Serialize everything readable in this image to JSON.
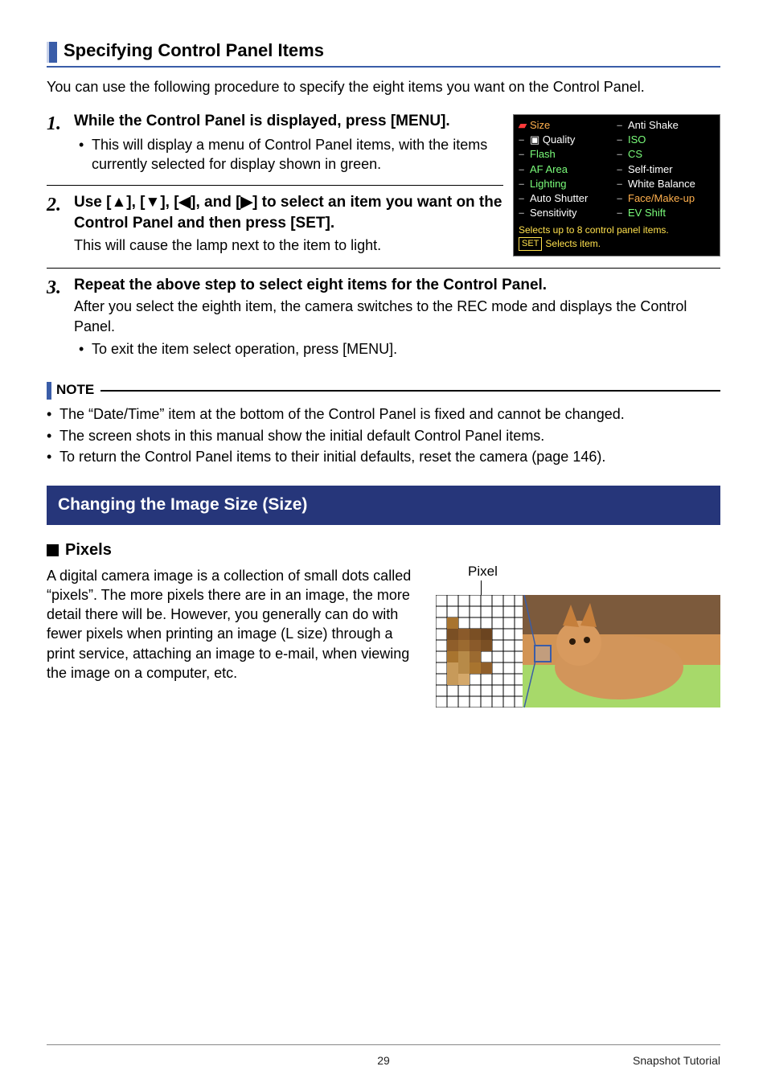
{
  "section1": {
    "title": "Specifying Control Panel Items",
    "intro": "You can use the following procedure to specify the eight items you want on the Control Panel."
  },
  "steps": {
    "s1": {
      "num": "1.",
      "title": "While the Control Panel is displayed, press [MENU].",
      "bullet": "This will display a menu of Control Panel items, with the items currently selected for display shown in green."
    },
    "s2": {
      "num": "2.",
      "title_pre": "Use [",
      "title_mid1": "], [",
      "title_mid2": "], [",
      "title_mid3": "], and [",
      "title_post": "] to select an item you want on the Control Panel and then press [SET].",
      "sub": "This will cause the lamp next to the item to light."
    },
    "s3": {
      "num": "3.",
      "title": "Repeat the above step to select eight items for the Control Panel.",
      "sub": "After you select the eighth item, the camera switches to the REC mode and displays the Control Panel.",
      "bullet": "To exit the item select operation, press [MENU]."
    }
  },
  "camera_menu": {
    "left": [
      "Size",
      "  Quality",
      "Flash",
      "AF Area",
      "Lighting",
      "Auto Shutter",
      "Sensitivity"
    ],
    "right": [
      "Anti Shake",
      "ISO",
      "CS",
      "Self-timer",
      "White Balance",
      "Face/Make-up",
      "EV Shift"
    ],
    "footer1": "Selects up to 8 control panel items.",
    "footer2_prefix": "SET",
    "footer2_text": "Selects item."
  },
  "note": {
    "label": "NOTE",
    "items": [
      "The “Date/Time” item at the bottom of the Control Panel is fixed and cannot be changed.",
      "The screen shots in this manual show the initial default Control Panel items.",
      "To return the Control Panel items to their initial defaults, reset the camera (page 146)."
    ]
  },
  "section2": {
    "banner": "Changing the Image Size (Size)",
    "sub_h": "Pixels",
    "pixel_label": "Pixel",
    "body": "A digital camera image is a collection of small dots called “pixels”. The more pixels there are in an image, the more detail there will be. However, you generally can do with fewer pixels when printing an image (L size) through a print service, attaching an image to e-mail, when viewing the image on a computer, etc."
  },
  "footer": {
    "page": "29",
    "section": "Snapshot Tutorial"
  }
}
